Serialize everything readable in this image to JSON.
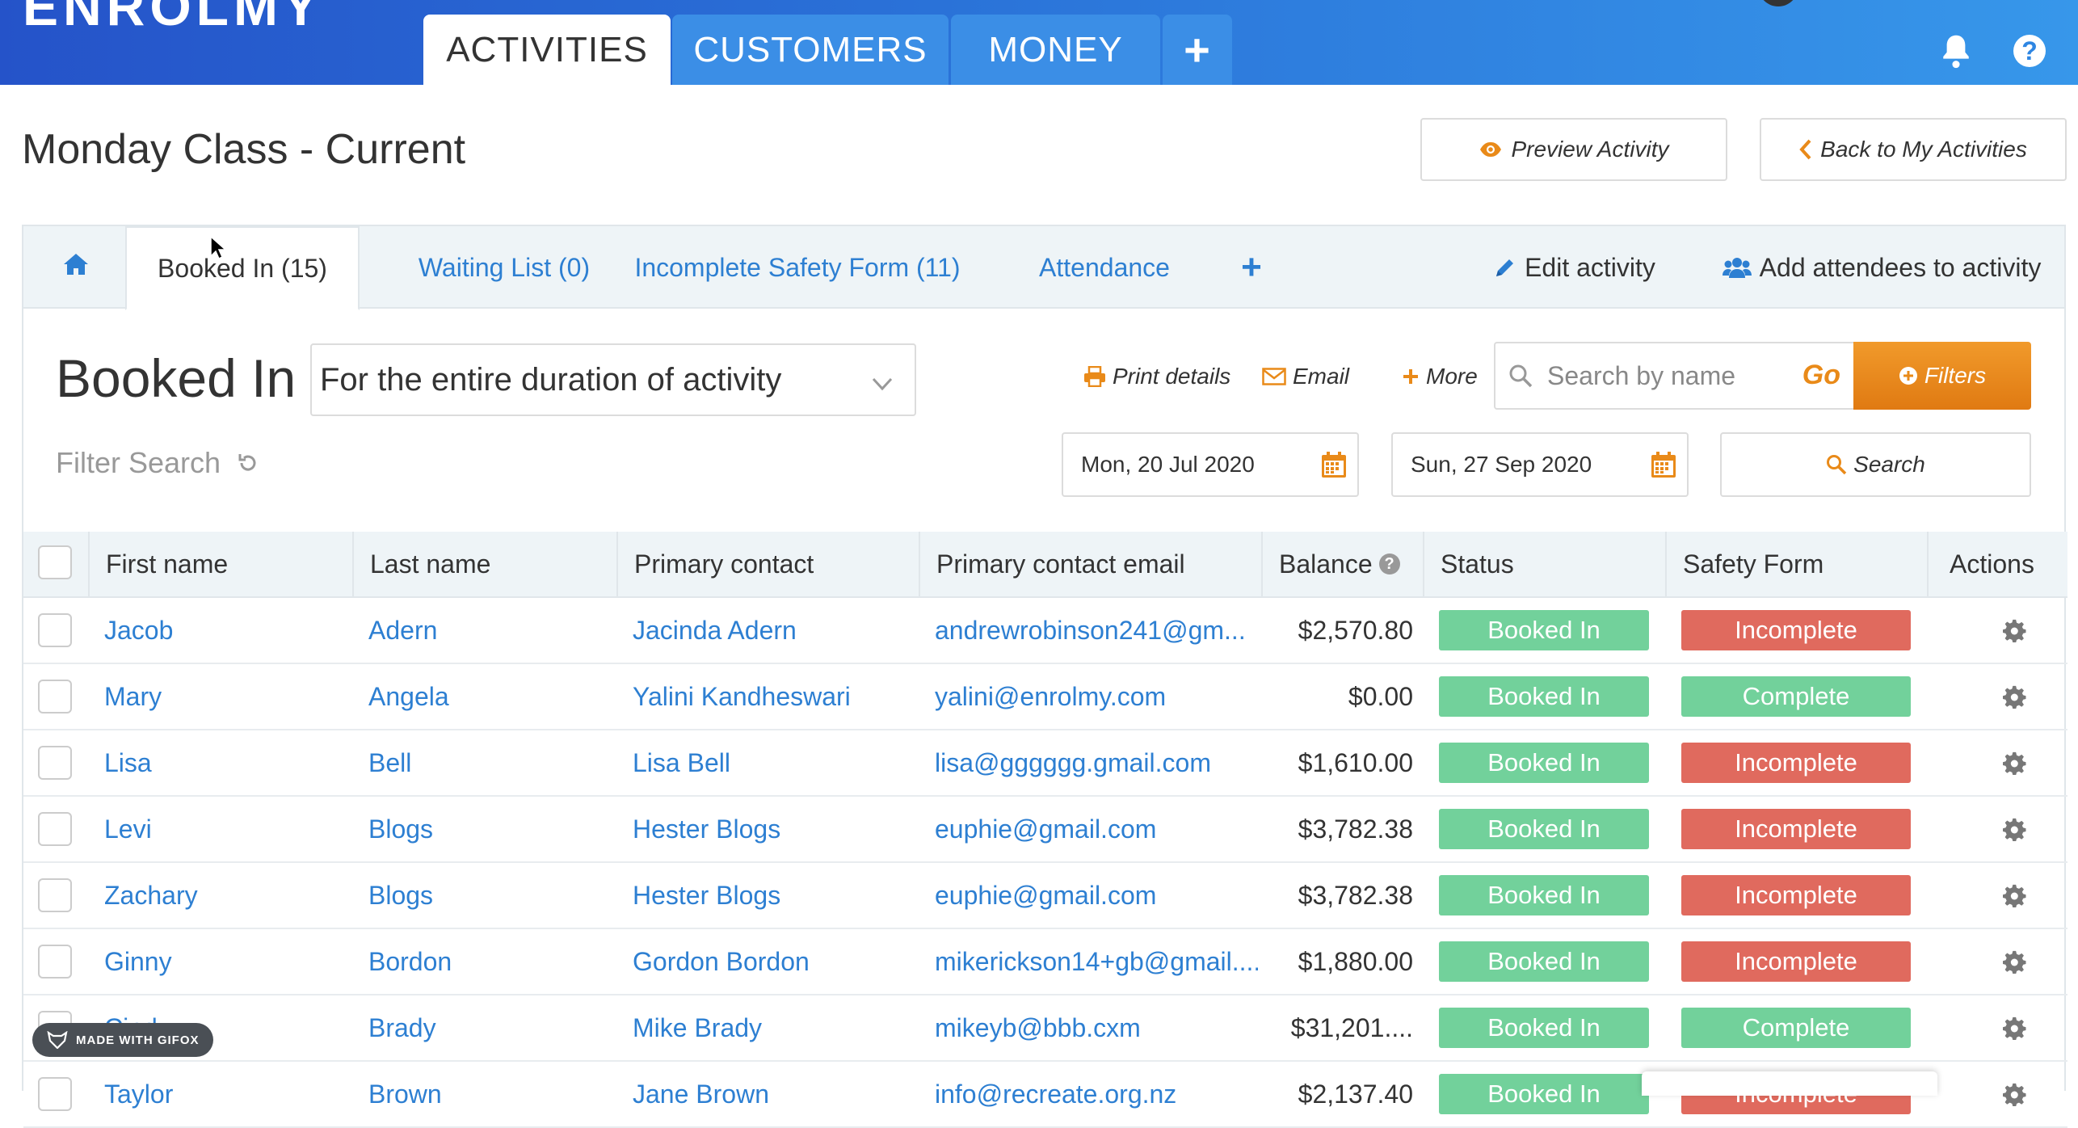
{
  "app": {
    "logo": "ENROLMY",
    "nav_tabs": [
      {
        "label": "ACTIVITIES"
      },
      {
        "label": "CUSTOMERS"
      },
      {
        "label": "MONEY"
      },
      {
        "label": "+"
      }
    ],
    "icons": [
      "bell-icon",
      "help-icon"
    ]
  },
  "header": {
    "title": "Monday Class - Current",
    "preview_label": "Preview Activity",
    "back_label": "Back to My Activities"
  },
  "tabs": {
    "booked_in": "Booked In (15)",
    "waiting_list": "Waiting List (0)",
    "incomplete_safety": "Incomplete Safety Form (11)",
    "attendance": "Attendance",
    "plus": "+",
    "edit_activity": "Edit activity",
    "add_attendees": "Add attendees to activity"
  },
  "toolbar": {
    "section_title": "Booked In",
    "duration_select": "For the entire duration of activity",
    "print_label": "Print details",
    "email_label": "Email",
    "more_label": "More",
    "search_placeholder": "Search by name",
    "go_label": "Go",
    "filters_label": "Filters",
    "filter_search_label": "Filter Search",
    "start_date": "Mon, 20 Jul 2020",
    "end_date": "Sun, 27 Sep 2020",
    "search_button": "Search"
  },
  "table": {
    "headers": {
      "first_name": "First name",
      "last_name": "Last name",
      "primary_contact": "Primary contact",
      "primary_email": "Primary contact email",
      "balance": "Balance",
      "status": "Status",
      "safety_form": "Safety Form",
      "actions": "Actions"
    },
    "rows": [
      {
        "first": "Jacob",
        "last": "Adern",
        "contact": "Jacinda Adern",
        "email": "andrewrobinson241@gm...",
        "balance": "$2,570.80",
        "status": "Booked In",
        "safety": "Incomplete"
      },
      {
        "first": "Mary",
        "last": "Angela",
        "contact": "Yalini Kandheswari",
        "email": "yalini@enrolmy.com",
        "balance": "$0.00",
        "status": "Booked In",
        "safety": "Complete"
      },
      {
        "first": "Lisa",
        "last": "Bell",
        "contact": "Lisa Bell",
        "email": "lisa@gggggg.gmail.com",
        "balance": "$1,610.00",
        "status": "Booked In",
        "safety": "Incomplete"
      },
      {
        "first": "Levi",
        "last": "Blogs",
        "contact": "Hester Blogs",
        "email": "euphie@gmail.com",
        "balance": "$3,782.38",
        "status": "Booked In",
        "safety": "Incomplete"
      },
      {
        "first": "Zachary",
        "last": "Blogs",
        "contact": "Hester Blogs",
        "email": "euphie@gmail.com",
        "balance": "$3,782.38",
        "status": "Booked In",
        "safety": "Incomplete"
      },
      {
        "first": "Ginny",
        "last": "Bordon",
        "contact": "Gordon Bordon",
        "email": "mikerickson14+gb@gmail....",
        "balance": "$1,880.00",
        "status": "Booked In",
        "safety": "Incomplete"
      },
      {
        "first": "Cindy",
        "last": "Brady",
        "contact": "Mike Brady",
        "email": "mikeyb@bbb.cxm",
        "balance": "$31,201....",
        "status": "Booked In",
        "safety": "Complete"
      },
      {
        "first": "Taylor",
        "last": "Brown",
        "contact": "Jane Brown",
        "email": "info@recreate.org.nz",
        "balance": "$2,137.40",
        "status": "Booked In",
        "safety": "Incomplete"
      }
    ]
  },
  "colors": {
    "booked_in": "#72d19b",
    "complete": "#72d19b",
    "incomplete": "#e06a5e",
    "link": "#2d7fd2",
    "accent_orange": "#e98a19"
  },
  "watermark": "MADE WITH GIFOX"
}
